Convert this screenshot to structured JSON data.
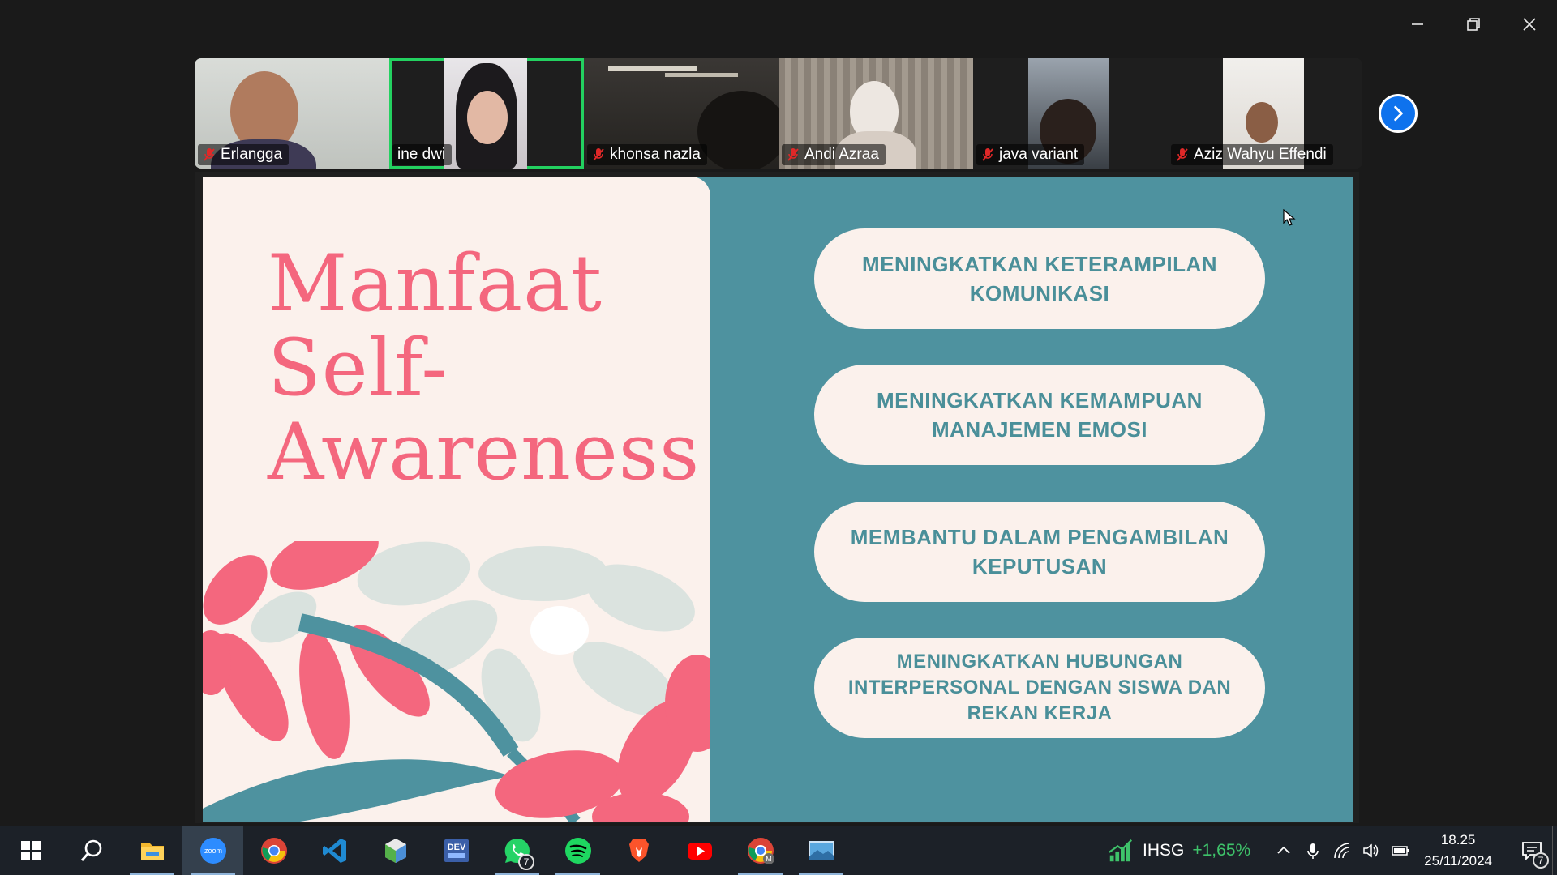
{
  "window": {
    "minimize_label": "Minimize",
    "restore_label": "Restore",
    "close_label": "Close"
  },
  "participants": [
    {
      "name": "Erlangga",
      "muted": true,
      "active": false
    },
    {
      "name": "ine dwi",
      "muted": false,
      "active": true
    },
    {
      "name": "khonsa nazla",
      "muted": true,
      "active": false
    },
    {
      "name": "Andi Azraa",
      "muted": true,
      "active": false
    },
    {
      "name": "java variant",
      "muted": true,
      "active": false
    },
    {
      "name": "Aziz Wahyu Effendi",
      "muted": true,
      "active": false
    }
  ],
  "slide": {
    "title_line1": "Manfaat",
    "title_line2": "Self-",
    "title_line3": "Awareness",
    "points": [
      "MENINGKATKAN KETERAMPILAN KOMUNIKASI",
      "MENINGKATKAN KEMAMPUAN MANAJEMEN EMOSI",
      "MEMBANTU DALAM PENGAMBILAN KEPUTUSAN",
      "MENINGKATKAN HUBUNGAN INTERPERSONAL DENGAN SISWA DAN REKAN KERJA"
    ],
    "colors": {
      "teal": "#4e929f",
      "cream": "#fbf1ec",
      "pink": "#f4677e",
      "text_teal": "#4a8f99"
    }
  },
  "taskbar": {
    "apps": [
      "start-icon",
      "search-icon",
      "file-explorer-icon",
      "zoom-icon",
      "chrome-icon",
      "vscode-icon",
      "app-cube-icon",
      "devtoys-icon",
      "whatsapp-icon",
      "spotify-icon",
      "brave-icon",
      "youtube-icon",
      "chrome-profile-icon",
      "photos-icon"
    ],
    "zoom_label": "zoom",
    "devtoys_label": "DEV",
    "whatsapp_badge": "7",
    "chrome_profile_letter": "M",
    "ihsg_label": "IHSG",
    "ihsg_change": "+1,65%",
    "time": "18.25",
    "date": "25/11/2024",
    "notification_count": "7"
  }
}
